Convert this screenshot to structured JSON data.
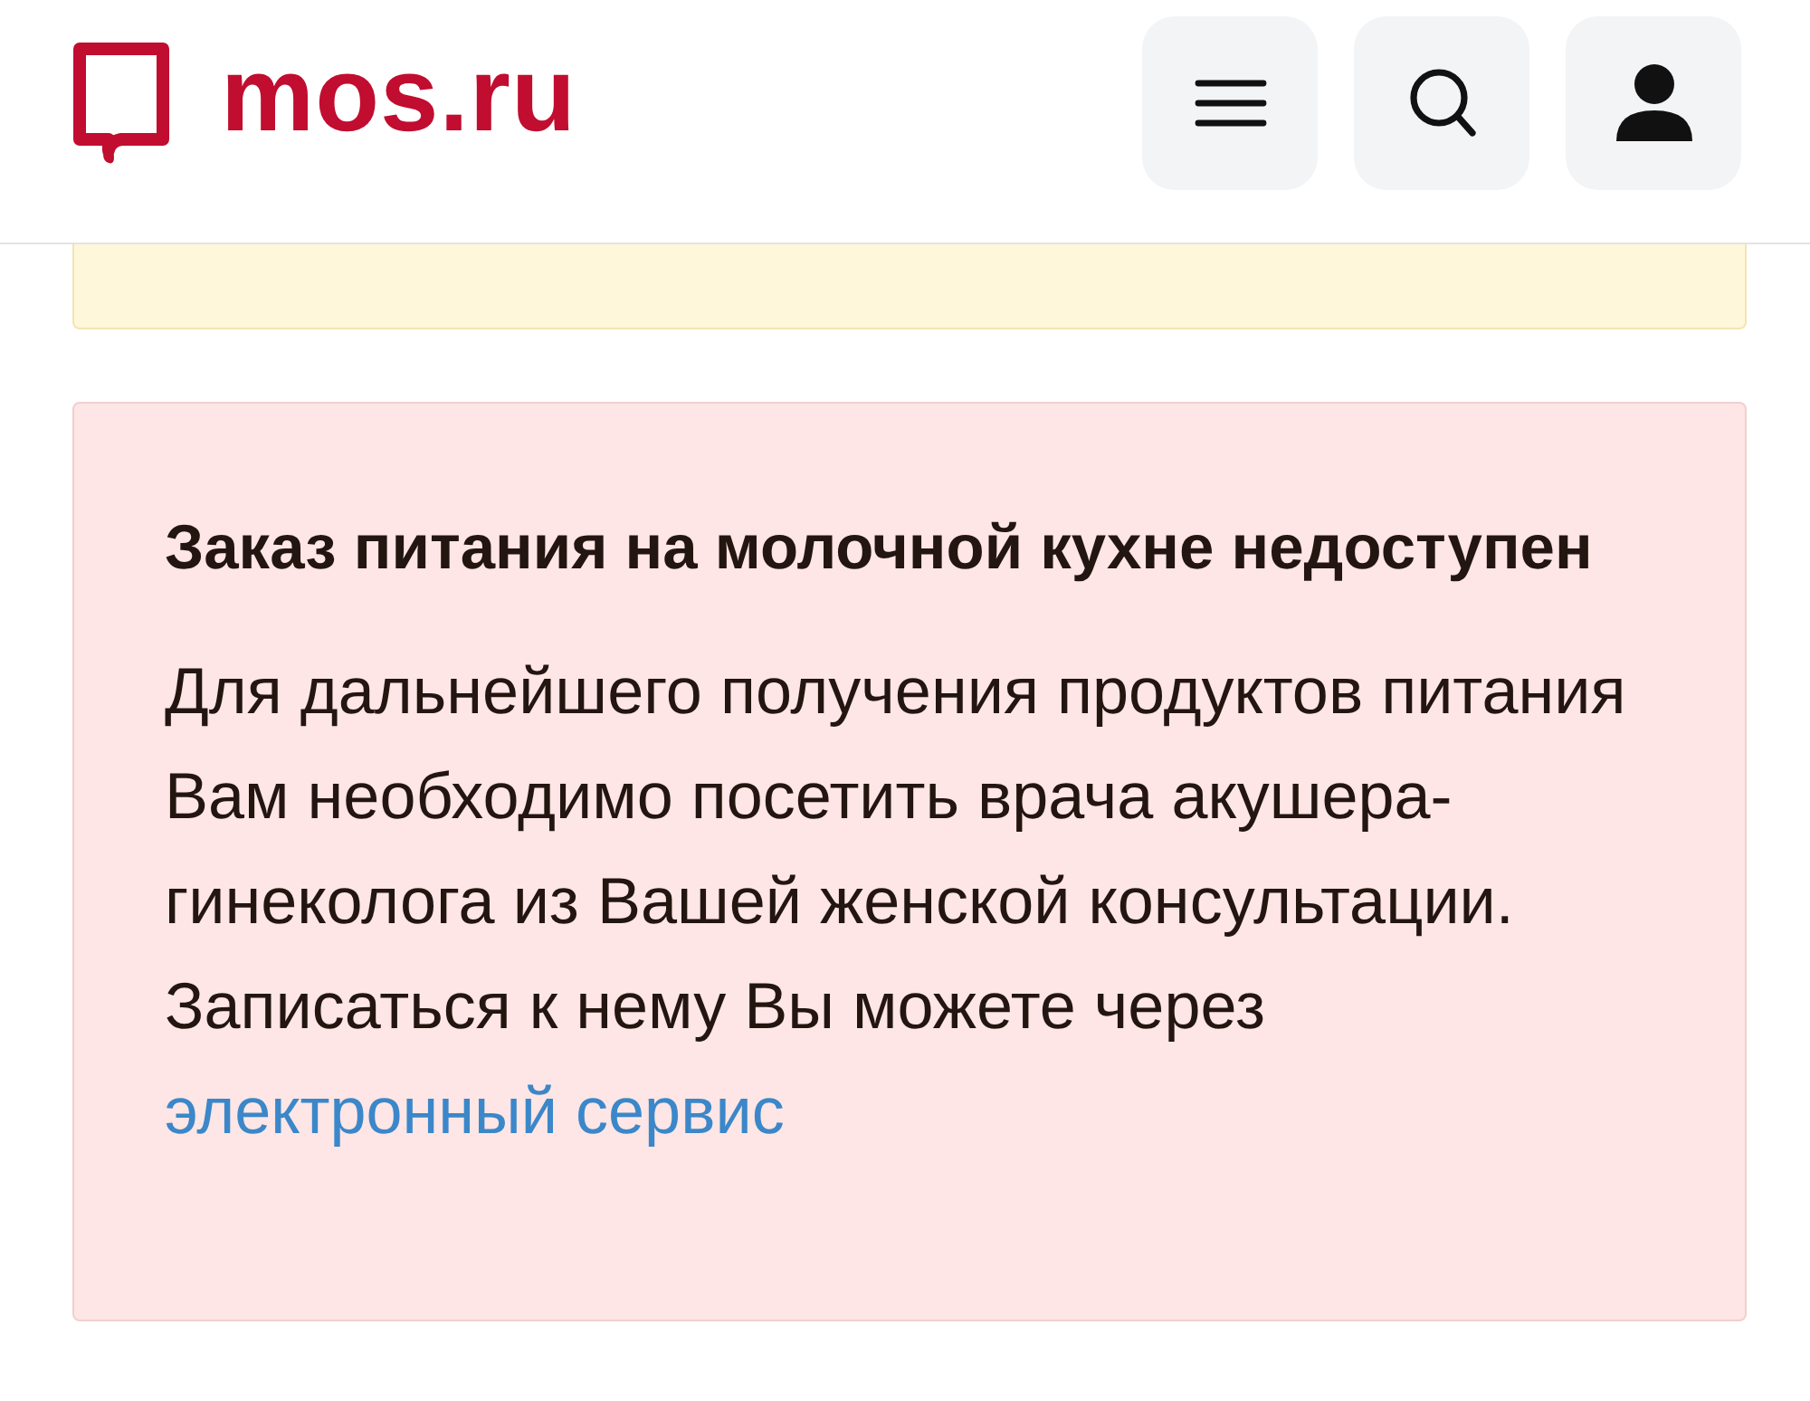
{
  "header": {
    "logo_text": "mos.ru",
    "buttons": [
      {
        "kind": "menu"
      },
      {
        "kind": "search"
      },
      {
        "kind": "profile"
      }
    ]
  },
  "notice": {
    "kind": "warning"
  },
  "alert": {
    "kind": "error",
    "title": "Заказ питания на молочной кухне недоступен",
    "text": "Для дальнейшего получения продуктов питания Вам необходимо посетить врача акушера-гинеколога из Вашей женской консультации. Записаться к нему Вы можете через",
    "link": "электронный сервис"
  }
}
